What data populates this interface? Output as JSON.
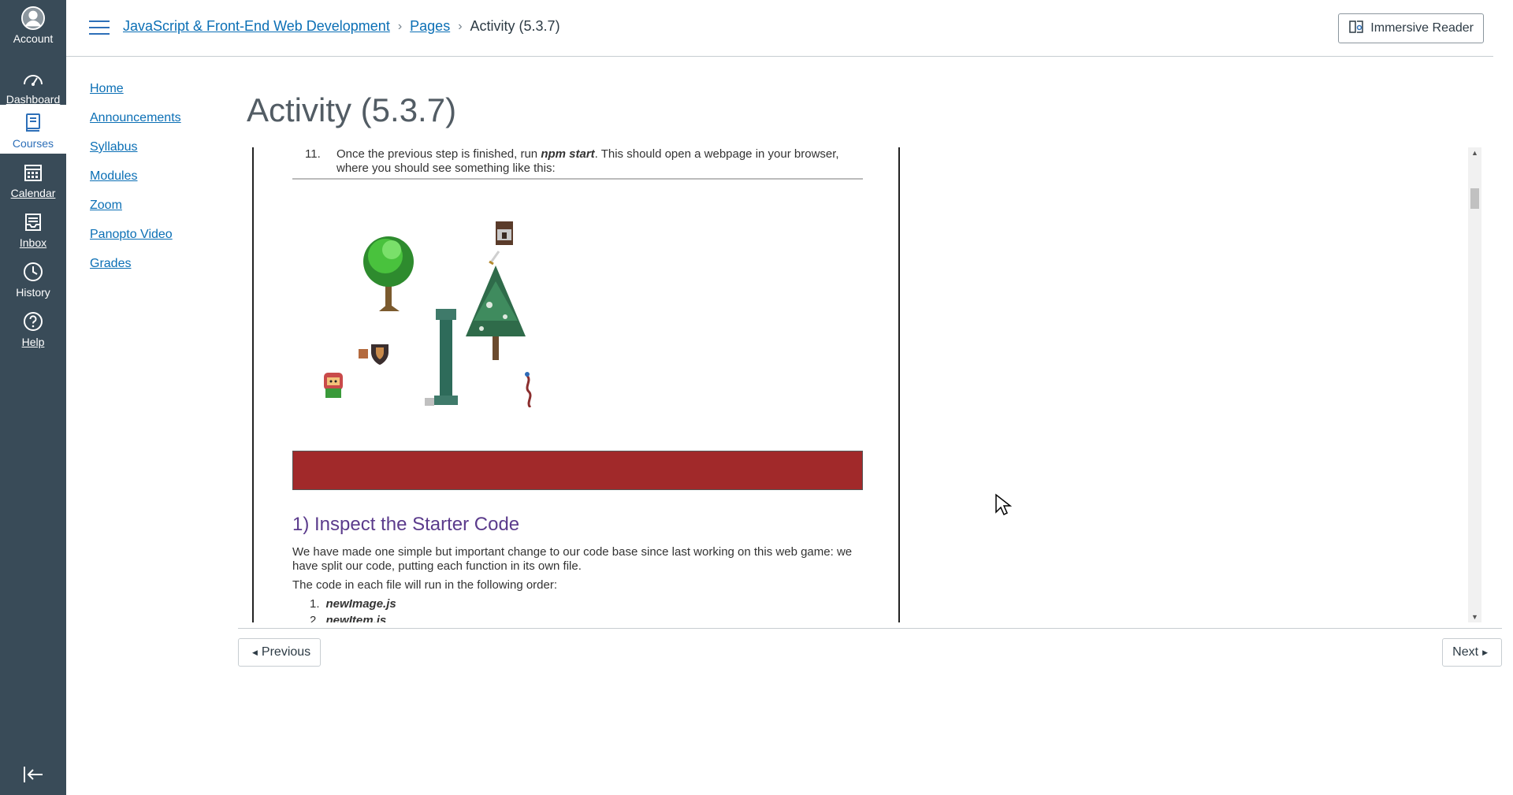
{
  "global_nav": {
    "items": [
      {
        "label": "Account",
        "icon": "account-icon"
      },
      {
        "label": "Dashboard",
        "icon": "dashboard-icon"
      },
      {
        "label": "Courses",
        "icon": "courses-icon"
      },
      {
        "label": "Calendar",
        "icon": "calendar-icon"
      },
      {
        "label": "Inbox",
        "icon": "inbox-icon"
      },
      {
        "label": "History",
        "icon": "history-icon"
      },
      {
        "label": "Help",
        "icon": "help-icon"
      }
    ],
    "colors": {
      "background": "#394b58",
      "active_background": "#ffffff"
    }
  },
  "header": {
    "breadcrumbs": [
      "JavaScript & Front-End Web Development",
      "Pages",
      "Activity (5.3.7)"
    ],
    "immersive_reader": "Immersive Reader"
  },
  "course_nav": [
    "Home",
    "Announcements",
    "Syllabus",
    "Modules",
    "Zoom",
    "Panopto Video",
    "Grades"
  ],
  "page": {
    "title": "Activity (5.3.7)",
    "step11_num": "11.",
    "step11_pre": "Once the previous step is finished, run ",
    "step11_cmd": "npm start",
    "step11_post": ". This should open a webpage in your browser, where you should see something like this:",
    "section_heading": "1) Inspect the Starter Code",
    "para1": "We have made one simple but important change to our code base since last working on this web game: we have split our code, putting each function in its own file.",
    "para2": "The code in each file will run in the following order:",
    "list": [
      {
        "num": "1.",
        "text": "newImage.js"
      },
      {
        "num": "2.",
        "text": "newItem.js"
      }
    ],
    "accent_bar_color": "#a1292a"
  },
  "footer": {
    "previous": "Previous",
    "next": "Next"
  }
}
